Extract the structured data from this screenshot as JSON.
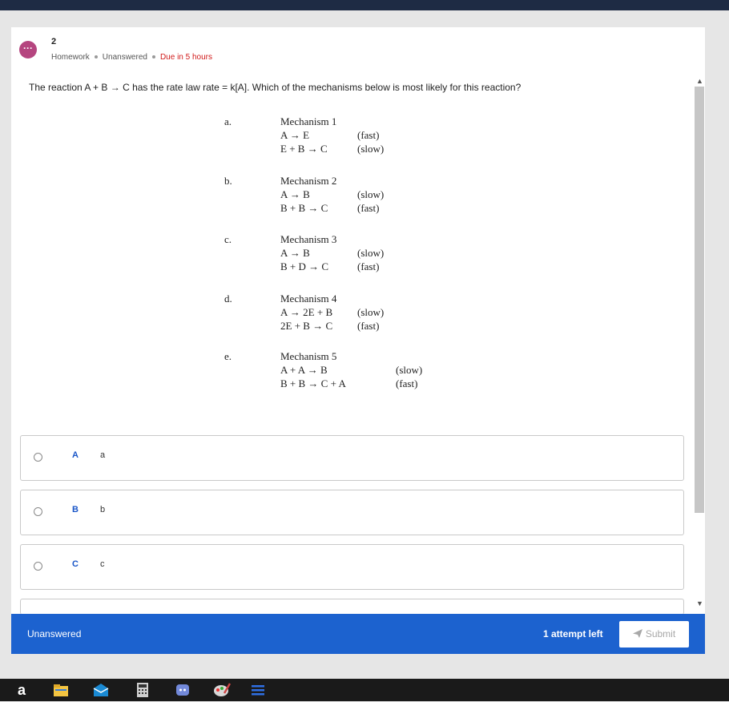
{
  "header": {
    "question_number": "2",
    "type": "Homework",
    "status": "Unanswered",
    "due": "Due in 5 hours",
    "avatar_icon": "chat-bubble-icon"
  },
  "question": {
    "text": "The reaction A + B → C has the rate law rate = k[A]. Which of the mechanisms below is most likely for this reaction?"
  },
  "mechanisms": [
    {
      "letter": "a.",
      "title": "Mechanism 1",
      "steps": [
        {
          "eq": "A → E",
          "rate": "(fast)"
        },
        {
          "eq": "E + B → C",
          "rate": "(slow)"
        }
      ]
    },
    {
      "letter": "b.",
      "title": "Mechanism 2",
      "steps": [
        {
          "eq": "A → B",
          "rate": "(slow)"
        },
        {
          "eq": "B + B → C",
          "rate": "(fast)"
        }
      ]
    },
    {
      "letter": "c.",
      "title": "Mechanism 3",
      "steps": [
        {
          "eq": "A → B",
          "rate": "(slow)"
        },
        {
          "eq": "B + D → C",
          "rate": "(fast)"
        }
      ]
    },
    {
      "letter": "d.",
      "title": "Mechanism 4",
      "steps": [
        {
          "eq": "A → 2E + B",
          "rate": "(slow)"
        },
        {
          "eq": "2E + B → C",
          "rate": "(fast)"
        }
      ]
    },
    {
      "letter": "e.",
      "title": "Mechanism 5",
      "steps": [
        {
          "eq": "A + A → B",
          "rate": "(slow)"
        },
        {
          "eq": "B + B → C + A",
          "rate": "(fast)"
        }
      ]
    }
  ],
  "choices": [
    {
      "key": "A",
      "value": "a"
    },
    {
      "key": "B",
      "value": "b"
    },
    {
      "key": "C",
      "value": "c"
    }
  ],
  "footer": {
    "status": "Unanswered",
    "attempts": "1 attempt left",
    "submit_label": "Submit",
    "submit_icon": "send-icon"
  },
  "colors": {
    "accent": "#1c62cf",
    "due": "#d11a1a",
    "avatar": "#b5457f",
    "topbar": "#1e2b44"
  },
  "taskbar": {
    "icons": [
      "amazon-icon",
      "file-explorer-icon",
      "mail-icon",
      "calculator-icon",
      "discord-icon",
      "paint-icon",
      "menu-icon"
    ],
    "amazon_letter": "a"
  }
}
